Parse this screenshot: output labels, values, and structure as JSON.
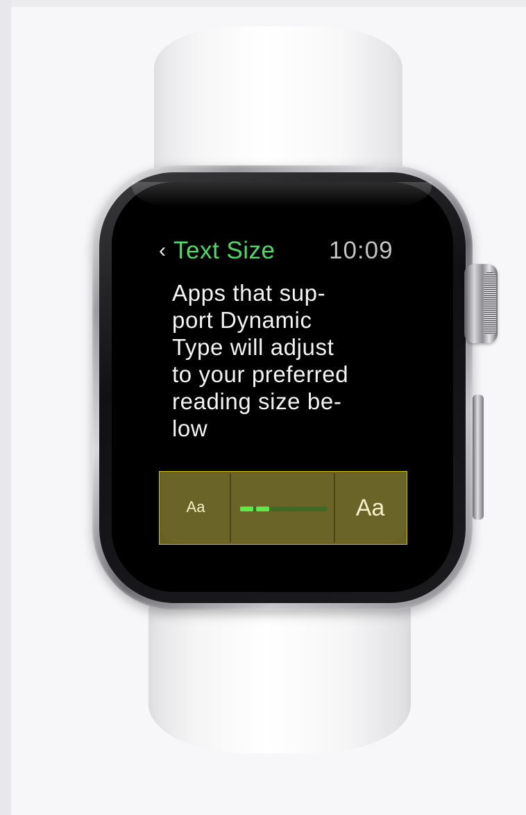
{
  "screen": {
    "back_chevron": "‹",
    "title": "Text Size",
    "time": "10:09",
    "description_lines": [
      "Apps that sup-",
      "port Dynamic",
      "Type will adjust",
      "to your preferred",
      "reading size be-",
      "low"
    ],
    "slider": {
      "decrease_label": "Aa",
      "increase_label": "Aa",
      "level_fraction": 0.33,
      "highlight_color": "#d6c50a",
      "fill_color": "#5ee84a"
    }
  },
  "colors": {
    "accent": "#4cd964",
    "screen_background": "#000000"
  },
  "icons": {
    "back": "chevron-left-icon",
    "crown": "digital-crown",
    "side_button": "side-button"
  }
}
